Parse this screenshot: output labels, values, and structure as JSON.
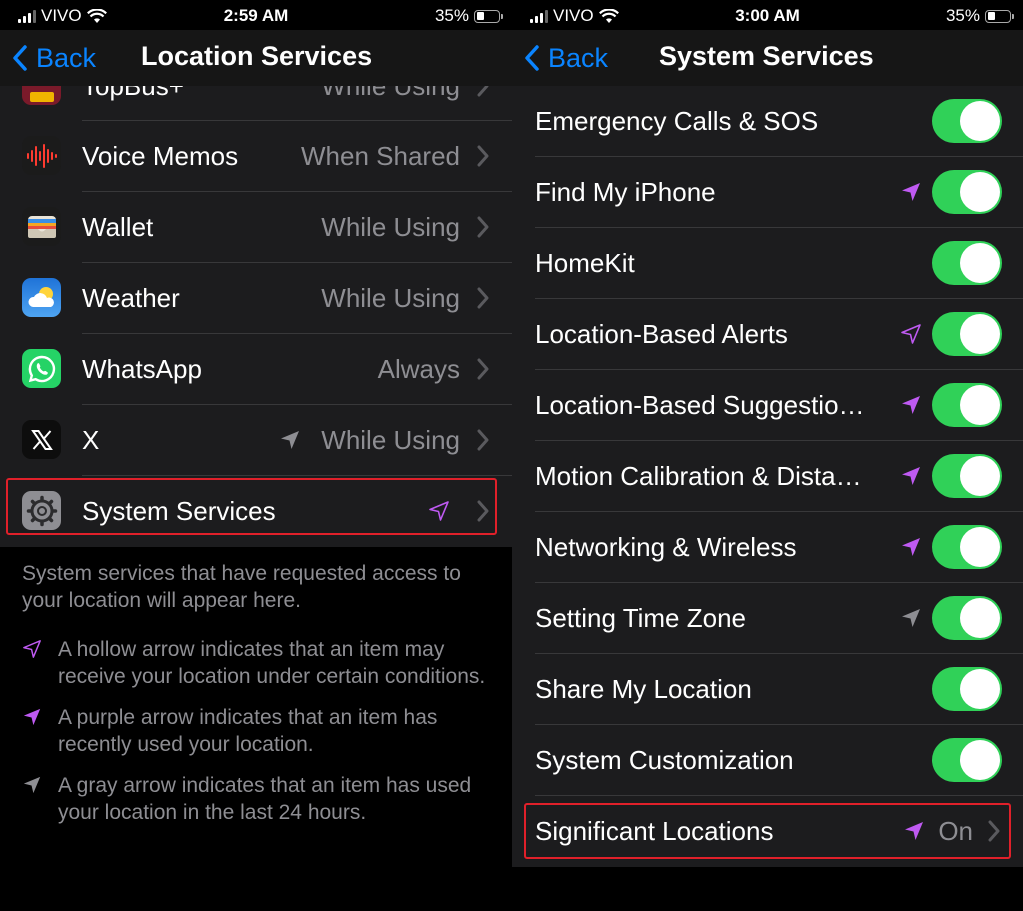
{
  "left": {
    "status": {
      "carrier": "VIVO",
      "time": "2:59 AM",
      "battery": "35%"
    },
    "nav": {
      "back_label": "Back",
      "title": "Location Services"
    },
    "rows": [
      {
        "label": "TopBus+",
        "value": "While Using"
      },
      {
        "label": "Voice Memos",
        "value": "When Shared"
      },
      {
        "label": "Wallet",
        "value": "While Using"
      },
      {
        "label": "Weather",
        "value": "While Using"
      },
      {
        "label": "WhatsApp",
        "value": "Always"
      },
      {
        "label": "X",
        "value": "While Using",
        "arrow": "gray-filled"
      },
      {
        "label": "System Services",
        "value": "",
        "arrow": "purple-hollow"
      }
    ],
    "footer": {
      "intro": "System services that have requested access to your location will appear here.",
      "legend": [
        {
          "icon": "purple-hollow-arrow-icon",
          "text": "A hollow arrow indicates that an item may receive your location under certain conditions."
        },
        {
          "icon": "purple-filled-arrow-icon",
          "text": "A purple arrow indicates that an item has recently used your location."
        },
        {
          "icon": "gray-filled-arrow-icon",
          "text": "A gray arrow indicates that an item has used your location in the last 24 hours."
        }
      ]
    }
  },
  "right": {
    "status": {
      "carrier": "VIVO",
      "time": "3:00 AM",
      "battery": "35%"
    },
    "nav": {
      "back_label": "Back",
      "title": "System Services"
    },
    "rows": [
      {
        "label": "Emergency Calls & SOS",
        "arrow": "none",
        "toggle": true
      },
      {
        "label": "Find My iPhone",
        "arrow": "purple-filled",
        "toggle": true
      },
      {
        "label": "HomeKit",
        "arrow": "none",
        "toggle": true
      },
      {
        "label": "Location-Based Alerts",
        "arrow": "purple-hollow",
        "toggle": true
      },
      {
        "label": "Location-Based Suggestio…",
        "arrow": "purple-filled",
        "toggle": true
      },
      {
        "label": "Motion Calibration & Dista…",
        "arrow": "purple-filled",
        "toggle": true
      },
      {
        "label": "Networking & Wireless",
        "arrow": "purple-filled",
        "toggle": true
      },
      {
        "label": "Setting Time Zone",
        "arrow": "gray-filled",
        "toggle": true
      },
      {
        "label": "Share My Location",
        "arrow": "none",
        "toggle": true
      },
      {
        "label": "System Customization",
        "arrow": "none",
        "toggle": true
      }
    ],
    "significant": {
      "label": "Significant Locations",
      "value": "On",
      "arrow": "purple-filled"
    }
  },
  "colors": {
    "accent": "#0a84ff",
    "purple": "#bf5af2",
    "gray_arrow": "#8e8e93",
    "toggle_on": "#30d158",
    "highlight": "#e0202a"
  }
}
